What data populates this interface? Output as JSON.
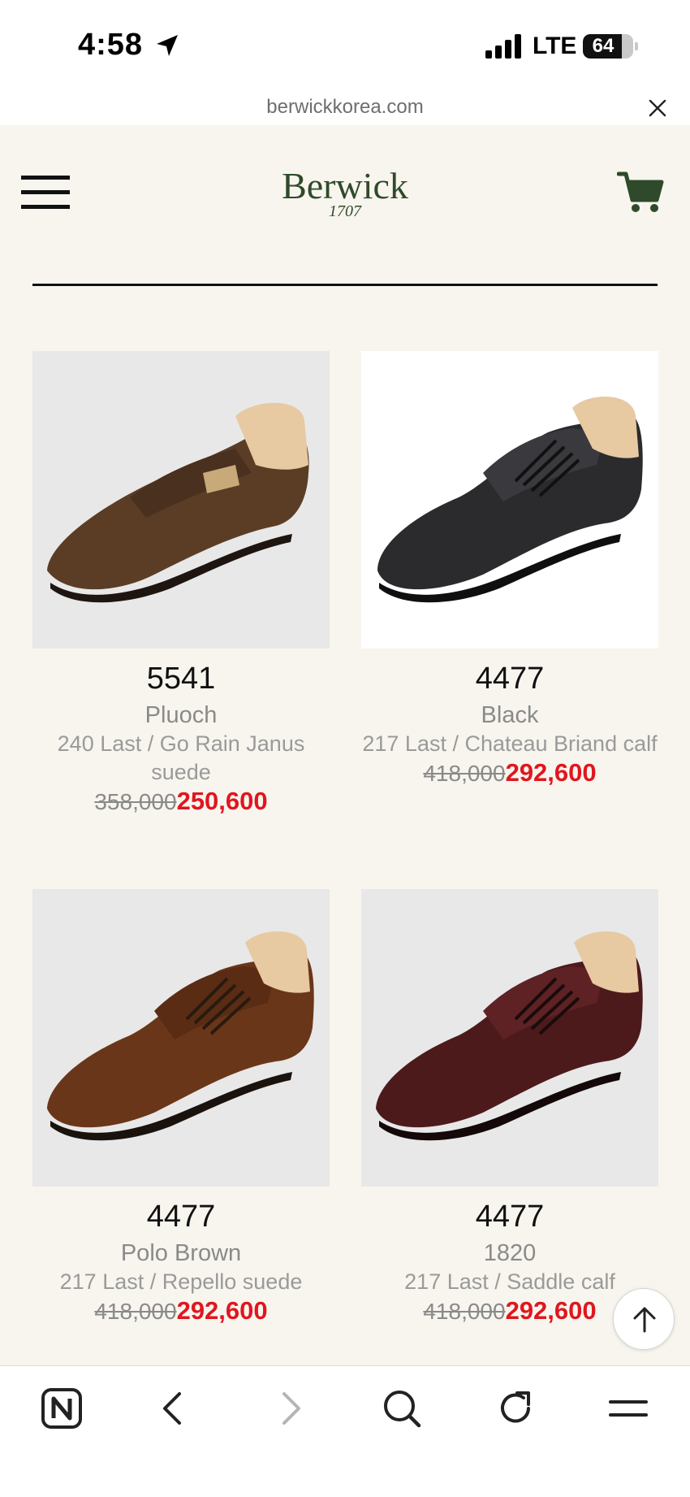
{
  "status": {
    "time": "4:58",
    "network": "LTE",
    "battery": "64",
    "battery_level": 0.64
  },
  "browser": {
    "url": "berwickkorea.com"
  },
  "header": {
    "logo_name": "Berwick",
    "logo_year": "1707"
  },
  "products": [
    {
      "code": "5541",
      "color": "Pluoch",
      "desc_line1": "240 Last / Go Rain Janus",
      "desc_line2": "suede",
      "old_price": "358,000",
      "new_price": "250,600"
    },
    {
      "code": "4477",
      "color": "Black",
      "desc_line1": "217 Last / Chateau Briand calf",
      "desc_line2": "",
      "old_price": "418,000",
      "new_price": "292,600"
    },
    {
      "code": "4477",
      "color": "Polo Brown",
      "desc_line1": "217 Last / Repello suede",
      "desc_line2": "",
      "old_price": "418,000",
      "new_price": "292,600"
    },
    {
      "code": "4477",
      "color": "1820",
      "desc_line1": "217 Last / Saddle calf",
      "desc_line2": "",
      "old_price": "418,000",
      "new_price": "292,600"
    }
  ],
  "icons": {
    "menu": "hamburger-menu-icon",
    "cart": "shopping-cart-icon",
    "close": "close-icon",
    "scroll_top": "arrow-up-icon",
    "naver_home": "naver-n-icon",
    "back": "chevron-left-icon",
    "forward": "chevron-right-icon",
    "search": "search-icon",
    "reload": "reload-icon",
    "more": "more-menu-icon"
  },
  "colors": {
    "page_bg": "#f7f5ee",
    "logo_green": "#2f4a2a",
    "sale_red": "#e0161f"
  }
}
